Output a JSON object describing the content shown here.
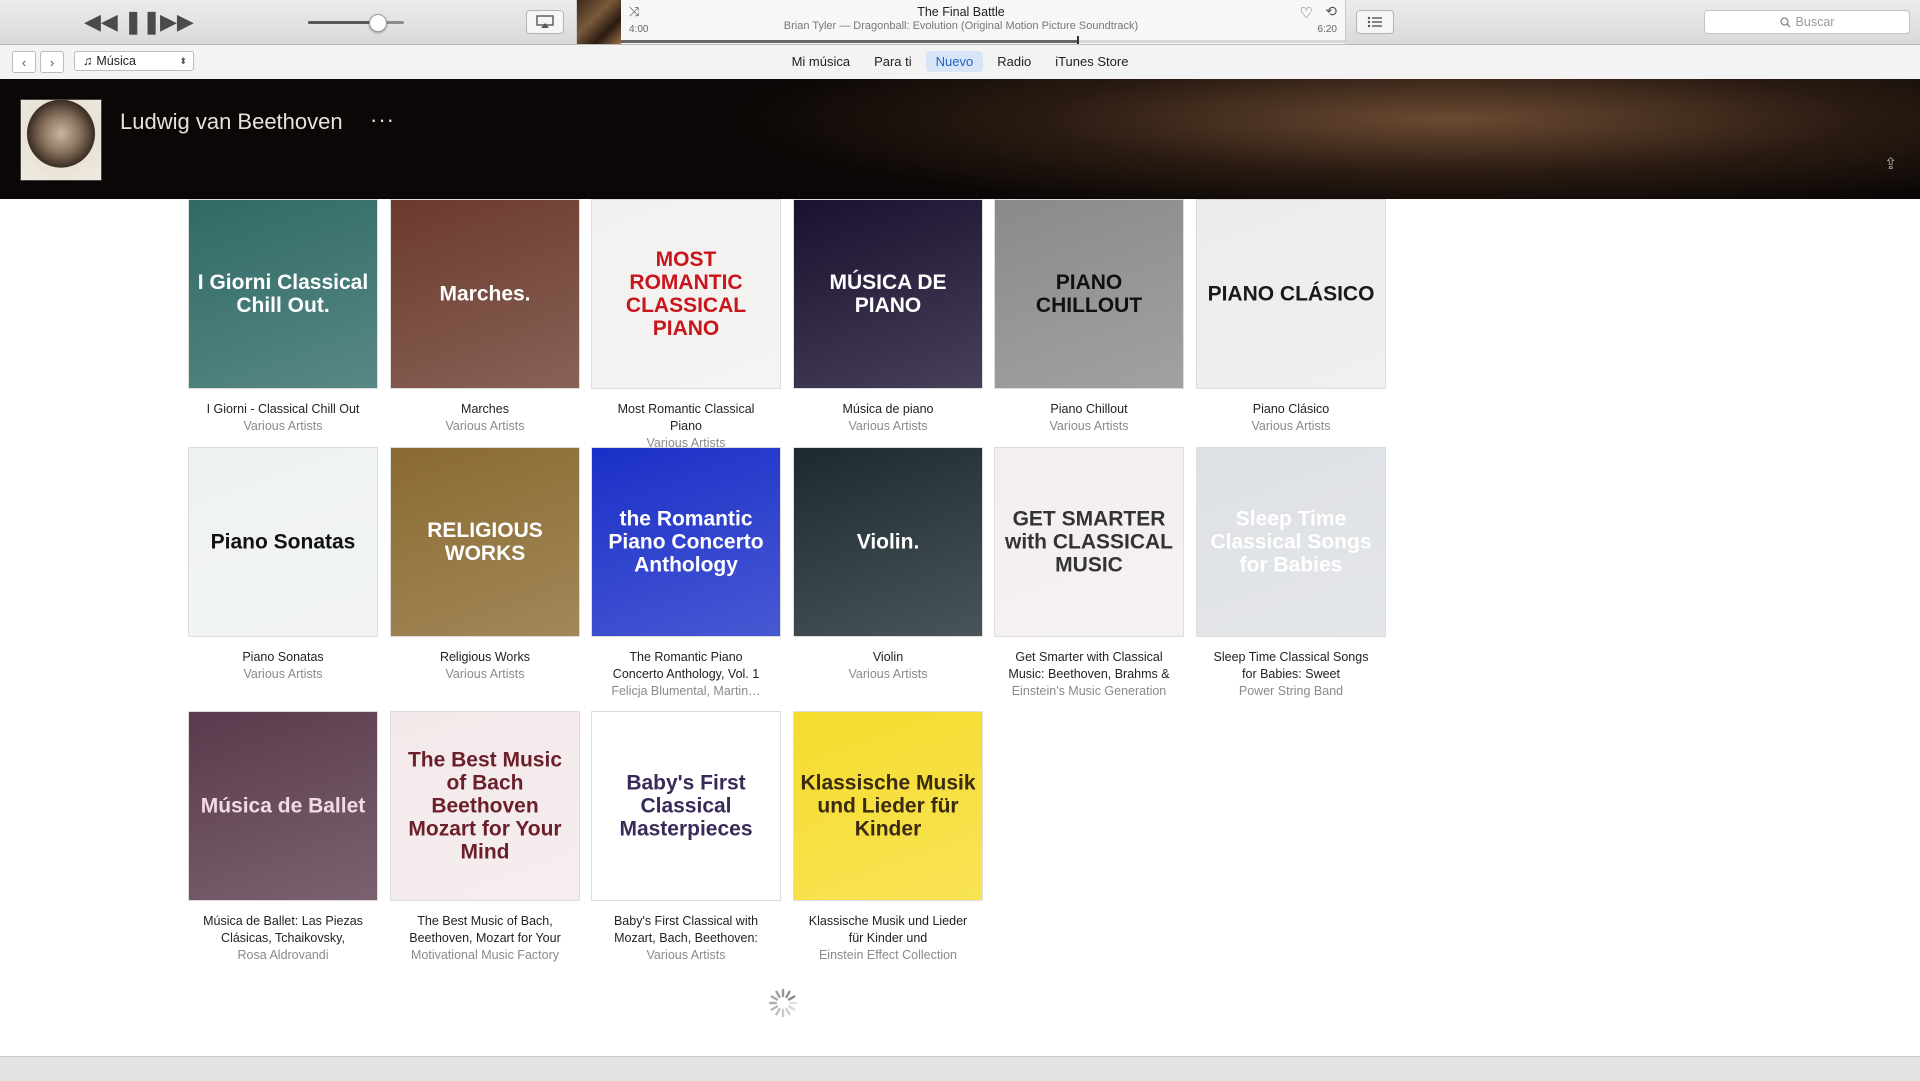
{
  "player": {
    "track_title": "The Final Battle",
    "track_subtitle": "Brian Tyler — Dragonball: Evolution (Original Motion Picture Soundtrack)",
    "elapsed": "4:00",
    "total": "6:20",
    "volume": 0.72,
    "progress": 0.63
  },
  "search": {
    "placeholder": "Buscar"
  },
  "nav": {
    "library": "Música",
    "tabs": [
      "Mi música",
      "Para ti",
      "Nuevo",
      "Radio",
      "iTunes Store"
    ],
    "active_tab": "Nuevo"
  },
  "artist": {
    "name": "Ludwig van Beethoven",
    "more": "···"
  },
  "albums": [
    {
      "title": "I Giorni - Classical Chill Out",
      "artist": "Various Artists",
      "cover_text": "I Giorni Classical Chill Out.",
      "bg": "#2f6a66",
      "fg": "#ffffff"
    },
    {
      "title": "Marches",
      "artist": "Various Artists",
      "cover_text": "Marches.",
      "bg": "#6b3a2c",
      "fg": "#ffffff"
    },
    {
      "title": "Most Romantic Classical Piano",
      "artist": "Various Artists",
      "cover_text": "MOST ROMANTIC CLASSICAL PIANO",
      "bg": "#f3f1ef",
      "fg": "#c8161d"
    },
    {
      "title": "Música de piano",
      "artist": "Various Artists",
      "cover_text": "MÚSICA DE PIANO",
      "bg": "#1a1030",
      "fg": "#ffffff"
    },
    {
      "title": "Piano Chillout",
      "artist": "Various Artists",
      "cover_text": "PIANO CHILLOUT",
      "bg": "#8a8a8a",
      "fg": "#111111"
    },
    {
      "title": "Piano Clásico",
      "artist": "Various Artists",
      "cover_text": "PIANO CLÁSICO",
      "bg": "#ececec",
      "fg": "#1a1a1a"
    },
    {
      "title": "Piano Sonatas",
      "artist": "Various Artists",
      "cover_text": "Piano Sonatas",
      "bg": "#eef2f0",
      "fg": "#111111"
    },
    {
      "title": "Religious Works",
      "artist": "Various Artists",
      "cover_text": "RELIGIOUS WORKS",
      "bg": "#8a6a30",
      "fg": "#ffffff"
    },
    {
      "title": "The Romantic Piano Concerto Anthology, Vol. 1",
      "artist": "Felicja Blumental, Martin…",
      "cover_text": "the Romantic Piano Concerto Anthology",
      "bg": "#1a2fc8",
      "fg": "#ffffff"
    },
    {
      "title": "Violin",
      "artist": "Various Artists",
      "cover_text": "Violin.",
      "bg": "#1c2a30",
      "fg": "#ffffff"
    },
    {
      "title": "Get Smarter with Classical Music: Beethoven, Brahms & Bach",
      "artist": "Einstein's Music Generation",
      "cover_text": "GET SMARTER with CLASSICAL MUSIC",
      "bg": "#f4eeee",
      "fg": "#333333"
    },
    {
      "title": "Sleep Time Classical Songs for Babies: Sweet",
      "artist": "Power String Band",
      "cover_text": "Sleep Time Classical Songs for Babies",
      "bg": "#dde0e4",
      "fg": "#ffffff"
    },
    {
      "title": "Música de Ballet: Las Piezas Clásicas, Tchaikovsky, Beethoven, Mozart",
      "artist": "Rosa Aldrovandi",
      "cover_text": "Música de Ballet",
      "bg": "#5a3a4c",
      "fg": "#f3d9e6"
    },
    {
      "title": "The Best Music of Bach, Beethoven, Mozart for Your Mind",
      "artist": "Motivational Music Factory",
      "cover_text": "The Best Music of Bach Beethoven Mozart for Your Mind",
      "bg": "#f3e9ea",
      "fg": "#6b1f2a"
    },
    {
      "title": "Baby's First Classical with Mozart, Bach, Beethoven: Masterpieces",
      "artist": "Various Artists",
      "cover_text": "Baby's First Classical Masterpieces",
      "bg": "#ffffff",
      "fg": "#3a2a5a"
    },
    {
      "title": "Klassische Musik und Lieder für Kinder und",
      "artist": "Einstein Effect Collection",
      "cover_text": "Klassische Musik und Lieder für Kinder",
      "bg": "#f6dc2c",
      "fg": "#3a2a10"
    }
  ]
}
